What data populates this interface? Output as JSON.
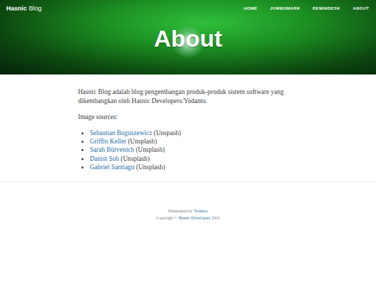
{
  "header": {
    "brand": {
      "bold": "Hasnic",
      "rest": "Blog"
    },
    "nav": [
      {
        "label": "HOME"
      },
      {
        "label": "JUMBOMARK"
      },
      {
        "label": "REMINDESK"
      },
      {
        "label": "ABOUT"
      }
    ],
    "title": "About"
  },
  "content": {
    "paragraph": "Hasnic Blog adalah blog pengembangan produk-produk sistem software yang dikembangkan oleh Hasnic Developers/Yodanto.",
    "sources_label": "Image sources:",
    "sources": [
      {
        "name": "Sebastian Boguszewicz",
        "suffix": "(Unspash)"
      },
      {
        "name": "Griffin Keller",
        "suffix": "(Unsplash)"
      },
      {
        "name": "Sarah Bürvenich",
        "suffix": "(Unsplash)"
      },
      {
        "name": "Danist Soh",
        "suffix": "(Unsplash)"
      },
      {
        "name": "Gabriel Santiago",
        "suffix": "(Unsplash)"
      }
    ]
  },
  "footer": {
    "maintained_label": "Maintained by",
    "maintainer": "Yodanto",
    "copyright_label": "Copyright ©",
    "company": "Hasnic Developers",
    "year": "2015"
  }
}
